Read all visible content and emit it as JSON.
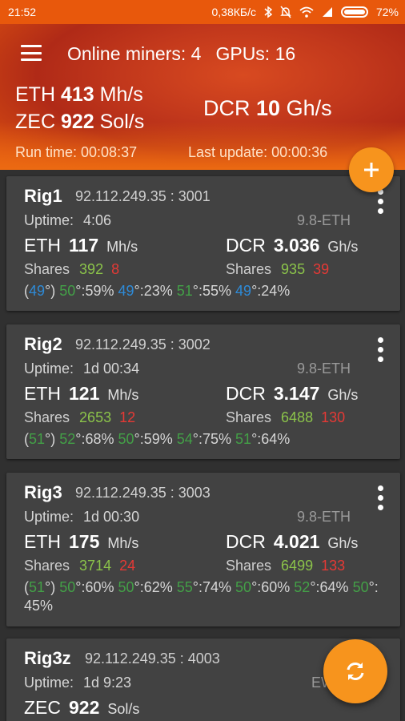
{
  "status_bar": {
    "time": "21:52",
    "speed": "0,38КБ/с",
    "battery": "72%"
  },
  "header": {
    "online_miners": "Online miners: 4",
    "gpus": "GPUs: 16",
    "eth_label": "ETH",
    "eth_value": "413",
    "eth_unit": "Mh/s",
    "zec_label": "ZEC",
    "zec_value": "922",
    "zec_unit": "Sol/s",
    "dcr_label": "DCR",
    "dcr_value": "10",
    "dcr_unit": "Gh/s",
    "run_time": "Run time: 00:08:37",
    "last_update": "Last update: 00:00:36"
  },
  "rigs": [
    {
      "name": "Rig1",
      "address": "92.112.249.35 : 3001",
      "uptime_label": "Uptime:",
      "uptime": "4:06",
      "version": "9.8-ETH",
      "algo1": {
        "label": "ETH",
        "value": "117",
        "unit": "Mh/s",
        "shares_label": "Shares",
        "accepted": "392",
        "rejected": "8"
      },
      "algo2": {
        "label": "DCR",
        "value": "3.036",
        "unit": "Gh/s",
        "shares_label": "Shares",
        "accepted": "935",
        "rejected": "39"
      }
    },
    {
      "name": "Rig2",
      "address": "92.112.249.35 : 3002",
      "uptime_label": "Uptime:",
      "uptime": "1d 00:34",
      "version": "9.8-ETH",
      "algo1": {
        "label": "ETH",
        "value": "121",
        "unit": "Mh/s",
        "shares_label": "Shares",
        "accepted": "2653",
        "rejected": "12"
      },
      "algo2": {
        "label": "DCR",
        "value": "3.147",
        "unit": "Gh/s",
        "shares_label": "Shares",
        "accepted": "6488",
        "rejected": "130"
      }
    },
    {
      "name": "Rig3",
      "address": "92.112.249.35 : 3003",
      "uptime_label": "Uptime:",
      "uptime": "1d 00:30",
      "version": "9.8-ETH",
      "algo1": {
        "label": "ETH",
        "value": "175",
        "unit": "Mh/s",
        "shares_label": "Shares",
        "accepted": "3714",
        "rejected": "24"
      },
      "algo2": {
        "label": "DCR",
        "value": "4.021",
        "unit": "Gh/s",
        "shares_label": "Shares",
        "accepted": "6499",
        "rejected": "133"
      }
    },
    {
      "name": "Rig3z",
      "address": "92.112.249.35 : 4003",
      "uptime_label": "Uptime:",
      "uptime": "1d 9:23",
      "version": "EW",
      "algo1": {
        "label": "ZEC",
        "value": "922",
        "unit": "Sol/s"
      }
    }
  ],
  "temps": {
    "rig1": [
      {
        "t": "(",
        "c": "plain"
      },
      {
        "t": "49",
        "c": "blue"
      },
      {
        "t": "°) ",
        "c": "plain"
      },
      {
        "t": "50",
        "c": "green"
      },
      {
        "t": "°:59% ",
        "c": "plain"
      },
      {
        "t": "49",
        "c": "blue"
      },
      {
        "t": "°:23% ",
        "c": "plain"
      },
      {
        "t": "51",
        "c": "green"
      },
      {
        "t": "°:55% ",
        "c": "plain"
      },
      {
        "t": "49",
        "c": "blue"
      },
      {
        "t": "°:24%",
        "c": "plain"
      }
    ],
    "rig2": [
      {
        "t": "(",
        "c": "plain"
      },
      {
        "t": "51",
        "c": "green"
      },
      {
        "t": "°) ",
        "c": "plain"
      },
      {
        "t": "52",
        "c": "green"
      },
      {
        "t": "°:68% ",
        "c": "plain"
      },
      {
        "t": "50",
        "c": "green"
      },
      {
        "t": "°:59% ",
        "c": "plain"
      },
      {
        "t": "54",
        "c": "green"
      },
      {
        "t": "°:75% ",
        "c": "plain"
      },
      {
        "t": "51",
        "c": "green"
      },
      {
        "t": "°:64%",
        "c": "plain"
      }
    ],
    "rig3": [
      {
        "t": "(",
        "c": "plain"
      },
      {
        "t": "51",
        "c": "green"
      },
      {
        "t": "°) ",
        "c": "plain"
      },
      {
        "t": "50",
        "c": "green"
      },
      {
        "t": "°:60% ",
        "c": "plain"
      },
      {
        "t": "50",
        "c": "green"
      },
      {
        "t": "°:62% ",
        "c": "plain"
      },
      {
        "t": "55",
        "c": "green"
      },
      {
        "t": "°:74% ",
        "c": "plain"
      },
      {
        "t": "50",
        "c": "green"
      },
      {
        "t": "°:60% ",
        "c": "plain"
      },
      {
        "t": "52",
        "c": "green"
      },
      {
        "t": "°:64% ",
        "c": "plain"
      },
      {
        "t": "50",
        "c": "green"
      },
      {
        "t": "°: 45%",
        "c": "plain"
      }
    ]
  },
  "colors": {
    "accent": "#f7941d",
    "header": "#c2381c",
    "ok": "#8bc34a",
    "bad": "#e53935",
    "temp_ok": "#43a047",
    "temp_cool": "#2e8bd8",
    "card": "#424242"
  },
  "icons": {
    "menu": "hamburger-icon",
    "add": "plus-icon",
    "refresh": "refresh-icon",
    "more": "kebab-icon"
  }
}
